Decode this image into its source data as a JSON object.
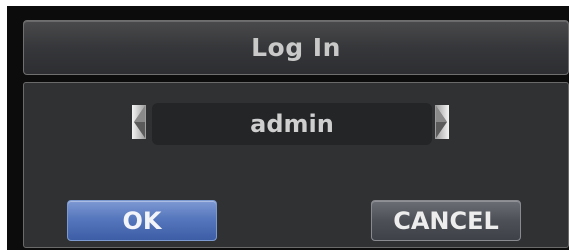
{
  "dialog": {
    "title": "Log In",
    "user_selector": {
      "value": "admin",
      "prev_icon": "arrow-left-icon",
      "next_icon": "arrow-right-icon"
    },
    "buttons": {
      "ok_label": "OK",
      "cancel_label": "CANCEL"
    }
  },
  "colors": {
    "background": "#0c0c0c",
    "panel": "#303133",
    "ok_button": "#5677bd",
    "cancel_button": "#4d5057",
    "text": "#cfcfcf"
  }
}
